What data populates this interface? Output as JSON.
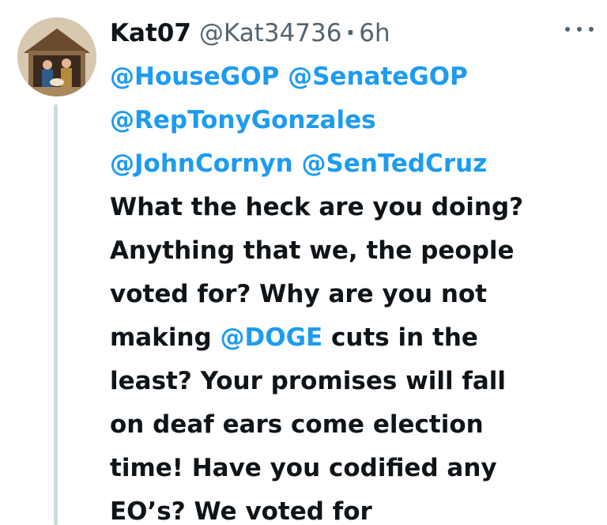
{
  "author": {
    "display_name": "Kat07",
    "handle": "@Kat34736",
    "separator": "·",
    "time": "6h"
  },
  "icons": {
    "avatar": "profile-photo-nativity",
    "more": "more-horizontal-icon"
  },
  "colors": {
    "mention": "#1d9bf0",
    "text": "#0f1419",
    "secondary": "#536471",
    "thread_line": "#cfd9de"
  },
  "tweet": {
    "mentions_line1": [
      "@HouseGOP",
      "@SenateGOP"
    ],
    "mentions_line2": [
      "@RepTonyGonzales"
    ],
    "mentions_line3": [
      "@JohnCornyn",
      "@SenTedCruz"
    ],
    "text_lines": [
      "What the heck are you doing?",
      "Anything that we, the people",
      "voted for? Why are you not"
    ],
    "line7_before": "making ",
    "line7_mention": "@DOGE",
    "line7_after": " cuts in the",
    "text_lines_after": [
      "least? Your promises will fall",
      "on deaf ears come election",
      "time! Have you codified any",
      "EO’s? We voted for"
    ]
  }
}
